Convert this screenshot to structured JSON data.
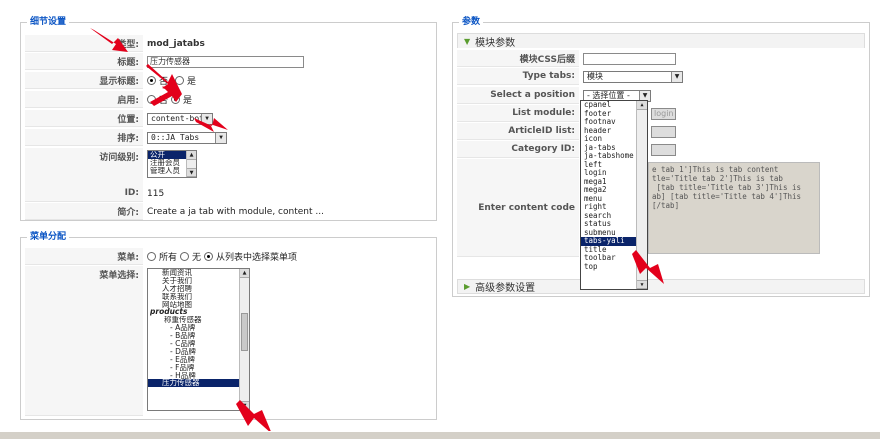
{
  "details": {
    "legend": "细节设置",
    "type_label": "类型:",
    "type_value": "mod_jatabs",
    "title_label": "标题:",
    "title_value": "压力传感器",
    "show_title_label": "显示标题:",
    "no": "否",
    "yes": "是",
    "enabled_label": "启用:",
    "position_label": "位置:",
    "position_value": "content-bot",
    "order_label": "排序:",
    "order_value": "0::JA Tabs",
    "access_label": "访问级别:",
    "access_options": [
      "公开",
      "注册会员",
      "管理人员"
    ],
    "id_label": "ID:",
    "id_value": "115",
    "desc_label": "简介:",
    "desc_value": "Create a ja tab with module, content ..."
  },
  "menu": {
    "legend": "菜单分配",
    "menu_label": "菜单:",
    "all": "所有",
    "none": "无",
    "select": "从列表中选择菜单项",
    "select_label": "菜单选择:",
    "items": [
      "新闻资讯",
      "关于我们",
      "人才招聘",
      "联系我们",
      "网站地图",
      "products",
      "称重传感器",
      "- A品牌",
      "- B品牌",
      "- C品牌",
      "- D品牌",
      "- E品牌",
      "- F品牌",
      "- H品牌",
      "压力传感器"
    ]
  },
  "params": {
    "legend": "参数",
    "module_params": "模块参数",
    "css_label": "模块CSS后缀",
    "tabtype_label": "Type tabs:",
    "tabtype_value": "模块",
    "position_label": "Select a position",
    "position_value": "- 选择位置 -",
    "list_module_label": "List module:",
    "list_module_value": "login",
    "articleid_label": "ArticleID list:",
    "category_label": "Category ID:",
    "content_label": "Enter content code",
    "content_value": "e tab 1']This is tab content\ntle='Title tab 2']This is tab\n [tab title='Title tab 3']This is\nab] [tab title='Title tab 4']This\n[/tab]",
    "advanced": "高级参数设置",
    "options": [
      "cpanel",
      "footer",
      "footnav",
      "header",
      "icon",
      "ja-tabs",
      "ja-tabshome",
      "left",
      "login",
      "mega1",
      "mega2",
      "menu",
      "right",
      "search",
      "status",
      "submenu",
      "tabs-yali",
      "title",
      "toolbar",
      "top"
    ]
  }
}
